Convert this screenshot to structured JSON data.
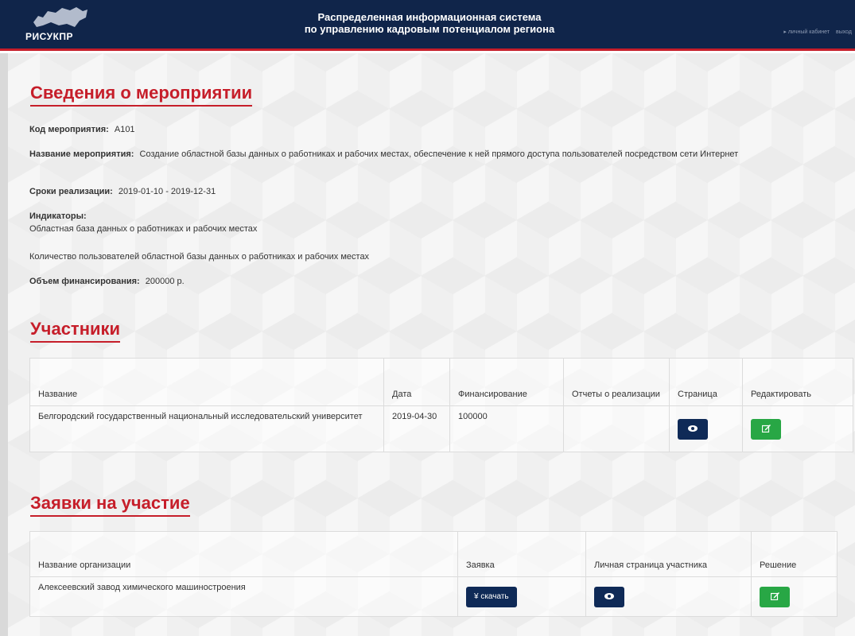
{
  "header": {
    "logo_text": "РИСУКПР",
    "title_line1": "Распределенная информационная система",
    "title_line2": "по управлению кадровым потенциалом региона",
    "link_cabinet": "▸ личный кабинет",
    "link_logout": "выход"
  },
  "event": {
    "section_title": "Сведения о мероприятии",
    "code_label": "Код мероприятия:",
    "code_value": "А101",
    "name_label": "Название мероприятия:",
    "name_value": "Создание областной базы данных о работниках и рабочих местах, обеспечение к ней прямого доступа пользователей посредством сети Интернет",
    "period_label": "Сроки реализации:",
    "period_value": "2019-01-10 - 2019-12-31",
    "indicators_label": "Индикаторы:",
    "indicators": [
      "Областная база данных о работниках и рабочих местах",
      "Количество пользователей областной базы данных о работниках и рабочих местах"
    ],
    "funding_label": "Объем финансирования:",
    "funding_value": "200000 р."
  },
  "participants": {
    "section_title": "Участники",
    "columns": [
      "Название",
      "Дата",
      "Финансирование",
      "Отчеты о реализации",
      "Страница",
      "Редактировать"
    ],
    "rows": [
      {
        "name": "Белгородский государственный национальный исследовательский университет",
        "date": "2019-04-30",
        "funding": "100000",
        "reports": ""
      }
    ]
  },
  "applications": {
    "section_title": "Заявки на участие",
    "columns": [
      "Название организации",
      "Заявка",
      "Личная страница участника",
      "Решение"
    ],
    "rows": [
      {
        "org": "Алексеевский завод химического машиностроения",
        "download_label": "¥ скачать"
      }
    ]
  },
  "icons": {
    "view": "eye-icon",
    "edit": "edit-icon",
    "download": "download-icon",
    "logo": "russia-map-icon"
  },
  "colors": {
    "header_bg": "#10254a",
    "accent_red": "#c61e2a",
    "btn_navy": "#0f2a57",
    "btn_green": "#28a745"
  }
}
